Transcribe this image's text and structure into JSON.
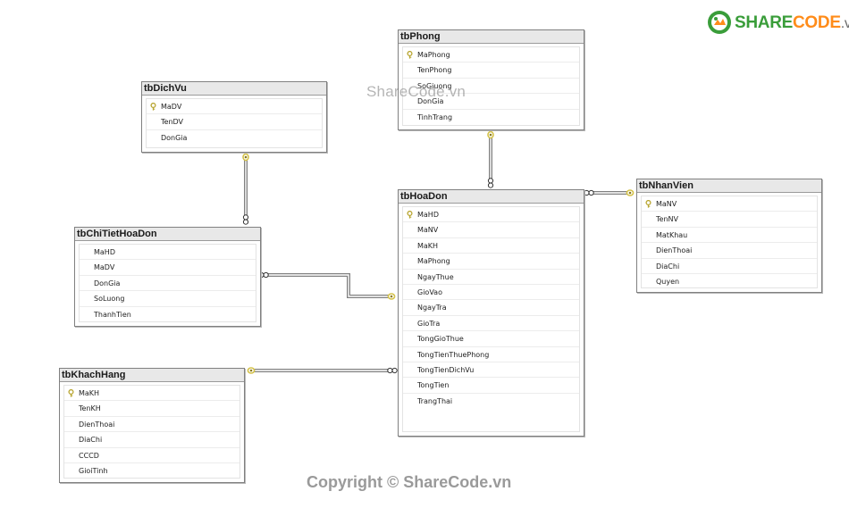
{
  "tables": [
    {
      "id": "tbPhong",
      "title": "tbPhong",
      "fields": [
        {
          "name": "MaPhong",
          "key": true
        },
        {
          "name": "TenPhong",
          "key": false
        },
        {
          "name": "SoGiuong",
          "key": false
        },
        {
          "name": "DonGia",
          "key": false
        },
        {
          "name": "TinhTrang",
          "key": false
        }
      ]
    },
    {
      "id": "tbDichVu",
      "title": "tbDichVu",
      "fields": [
        {
          "name": "MaDV",
          "key": true
        },
        {
          "name": "TenDV",
          "key": false
        },
        {
          "name": "DonGia",
          "key": false
        }
      ]
    },
    {
      "id": "tbHoaDon",
      "title": "tbHoaDon",
      "fields": [
        {
          "name": "MaHD",
          "key": true
        },
        {
          "name": "MaNV",
          "key": false
        },
        {
          "name": "MaKH",
          "key": false
        },
        {
          "name": "MaPhong",
          "key": false
        },
        {
          "name": "NgayThue",
          "key": false
        },
        {
          "name": "GioVao",
          "key": false
        },
        {
          "name": "NgayTra",
          "key": false
        },
        {
          "name": "GioTra",
          "key": false
        },
        {
          "name": "TongGioThue",
          "key": false
        },
        {
          "name": "TongTienThuePhong",
          "key": false
        },
        {
          "name": "TongTienDichVu",
          "key": false
        },
        {
          "name": "TongTien",
          "key": false
        },
        {
          "name": "TrangThai",
          "key": false
        }
      ]
    },
    {
      "id": "tbNhanVien",
      "title": "tbNhanVien",
      "fields": [
        {
          "name": "MaNV",
          "key": true
        },
        {
          "name": "TenNV",
          "key": false
        },
        {
          "name": "MatKhau",
          "key": false
        },
        {
          "name": "DienThoai",
          "key": false
        },
        {
          "name": "DiaChi",
          "key": false
        },
        {
          "name": "Quyen",
          "key": false
        }
      ]
    },
    {
      "id": "tbChiTietHoaDon",
      "title": "tbChiTietHoaDon",
      "fields": [
        {
          "name": "MaHD",
          "key": false
        },
        {
          "name": "MaDV",
          "key": false
        },
        {
          "name": "DonGia",
          "key": false
        },
        {
          "name": "SoLuong",
          "key": false
        },
        {
          "name": "ThanhTien",
          "key": false
        }
      ]
    },
    {
      "id": "tbKhachHang",
      "title": "tbKhachHang",
      "fields": [
        {
          "name": "MaKH",
          "key": true
        },
        {
          "name": "TenKH",
          "key": false
        },
        {
          "name": "DienThoai",
          "key": false
        },
        {
          "name": "DiaChi",
          "key": false
        },
        {
          "name": "CCCD",
          "key": false
        },
        {
          "name": "GioiTinh",
          "key": false
        }
      ]
    }
  ],
  "relationships": [
    {
      "one": "tbPhong",
      "many": "tbHoaDon"
    },
    {
      "one": "tbDichVu",
      "many": "tbChiTietHoaDon"
    },
    {
      "one": "tbNhanVien",
      "many": "tbHoaDon"
    },
    {
      "one": "tbHoaDon",
      "many": "tbChiTietHoaDon"
    },
    {
      "one": "tbKhachHang",
      "many": "tbHoaDon"
    }
  ],
  "watermarks": {
    "center": "ShareCode.vn",
    "footer": "Copyright © ShareCode.vn"
  },
  "logo": {
    "part1": "SHARE",
    "part2": "CODE",
    "part3": ".vn"
  },
  "colors": {
    "line": "#808080",
    "key": "#d4c24a",
    "one_end": "#d4c24a",
    "logo_green": "#3a9d3a",
    "logo_orange": "#ff8c1a"
  }
}
